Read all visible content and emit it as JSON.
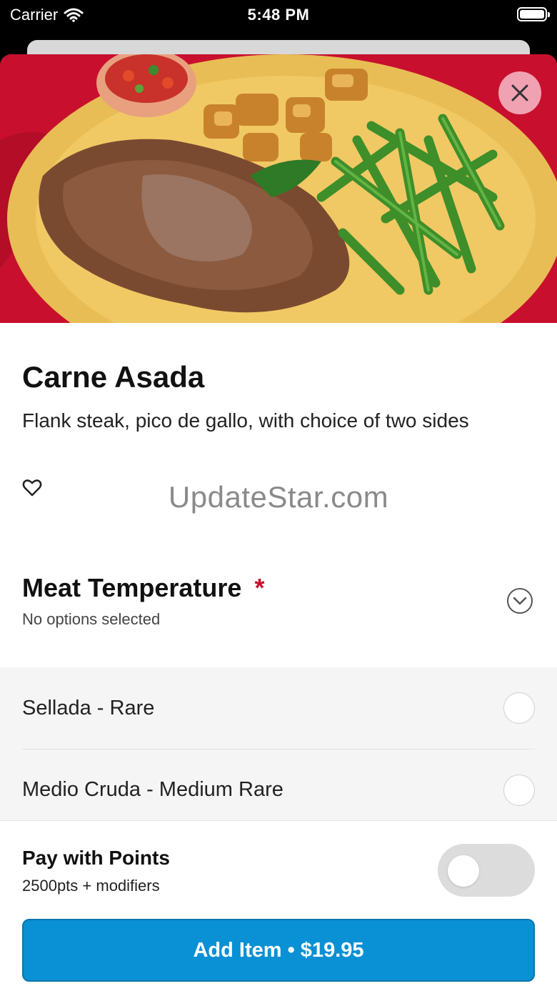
{
  "status_bar": {
    "carrier": "Carrier",
    "time": "5:48 PM",
    "icons": [
      "wifi-icon",
      "battery-icon"
    ]
  },
  "item": {
    "image_alt": "carne asada plate",
    "title": "Carne Asada",
    "description": "Flank steak, pico de gallo, with choice of two sides",
    "favorite_icon": "heart-outline-icon",
    "close_icon": "close-icon"
  },
  "watermark": "UpdateStar.com",
  "modifier_group": {
    "title": "Meat Temperature",
    "required_marker": "*",
    "subtitle": "No options selected",
    "expand_icon": "chevron-down-circle-icon",
    "options": [
      {
        "label": "Sellada - Rare",
        "selected": false
      },
      {
        "label": "Medio Cruda - Medium Rare",
        "selected": false
      }
    ]
  },
  "points": {
    "title": "Pay with Points",
    "subtitle": "2500pts + modifiers",
    "enabled": false
  },
  "add_button": {
    "label": "Add Item • $19.95"
  },
  "colors": {
    "accent": "#0a90d4",
    "required": "#c8102e",
    "close_bg": "#f1a2b2"
  }
}
